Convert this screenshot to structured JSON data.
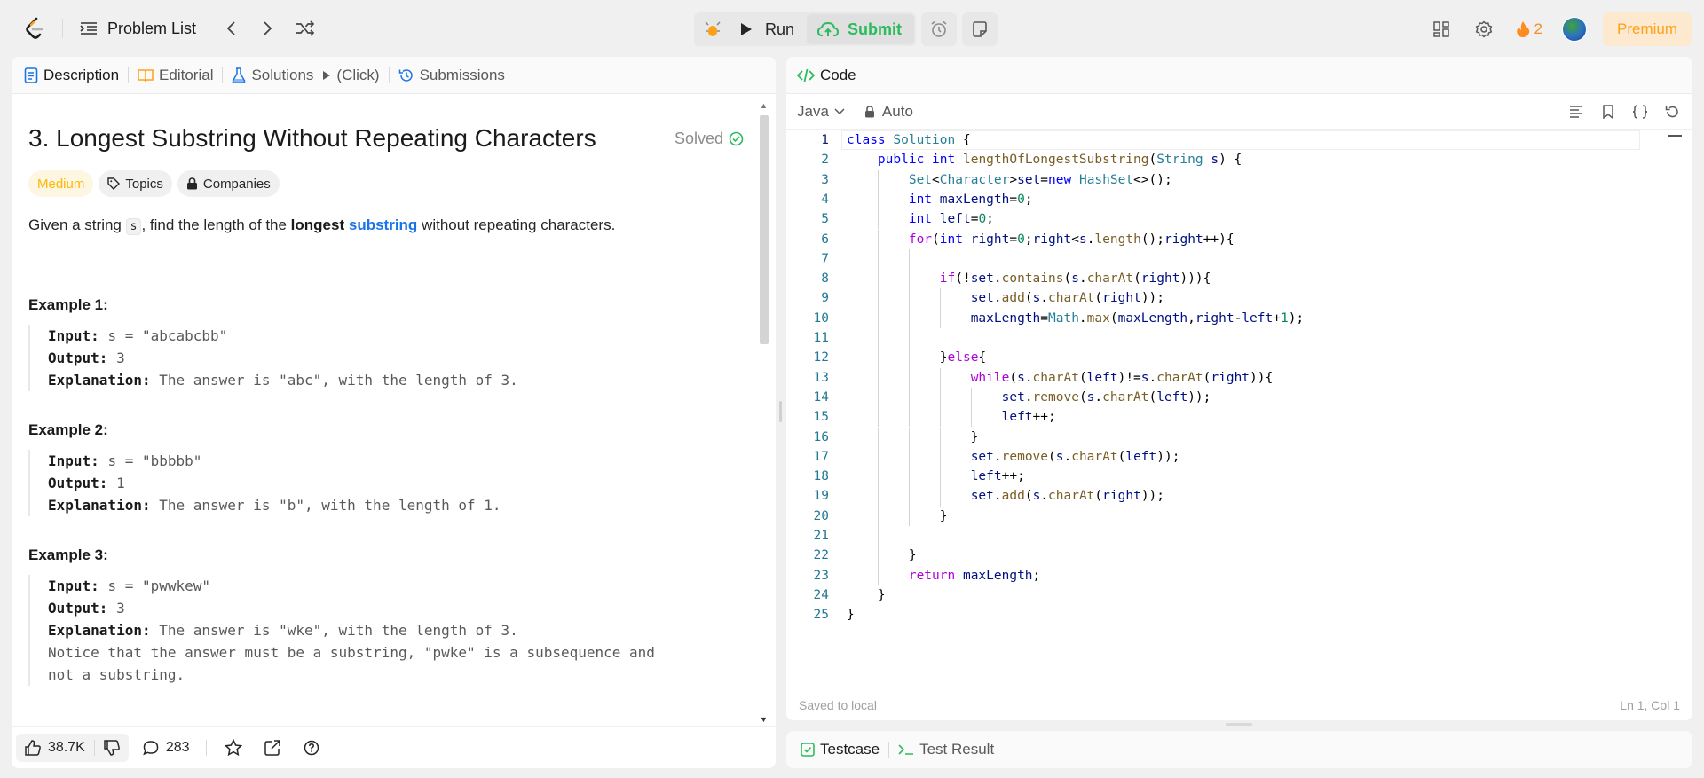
{
  "nav": {
    "problem_list": "Problem List",
    "run": "Run",
    "submit": "Submit",
    "streak": "2",
    "premium": "Premium"
  },
  "left_tabs": [
    {
      "label": "Description",
      "icon": "description-icon"
    },
    {
      "label": "Editorial",
      "icon": "book-icon"
    },
    {
      "label": "Solutions",
      "icon": "flask-icon"
    },
    {
      "label": "(Click)",
      "icon": "play-icon"
    },
    {
      "label": "Submissions",
      "icon": "history-icon"
    }
  ],
  "problem": {
    "title": "3. Longest Substring Without Repeating Characters",
    "status": "Solved",
    "difficulty": "Medium",
    "topics_label": "Topics",
    "companies_label": "Companies",
    "statement": {
      "p1": "Given a string ",
      "code": "s",
      "p2": ", find the length of the ",
      "bold": "longest",
      "link": "substring",
      "p3": " without repeating characters."
    },
    "examples": [
      {
        "title": "Example 1:",
        "input": "s = \"abcabcbb\"",
        "output": "3",
        "explanation": "The answer is \"abc\", with the length of 3."
      },
      {
        "title": "Example 2:",
        "input": "s = \"bbbbb\"",
        "output": "1",
        "explanation": "The answer is \"b\", with the length of 1."
      },
      {
        "title": "Example 3:",
        "input": "s = \"pwwkew\"",
        "output": "3",
        "explanation": "The answer is \"wke\", with the length of 3.",
        "note1": "Notice that the answer must be a substring, \"pwke\" is a subsequence and",
        "note2": "not a substring."
      }
    ],
    "labels": {
      "input": "Input:",
      "output": "Output:",
      "explanation": "Explanation:"
    }
  },
  "footer": {
    "likes": "38.7K",
    "comments": "283"
  },
  "code_panel": {
    "title": "Code",
    "language": "Java",
    "mode": "Auto",
    "status_left": "Saved to local",
    "status_right": "Ln 1, Col 1"
  },
  "code_lines": [
    "class Solution {",
    "    public int lengthOfLongestSubstring(String s) {",
    "        Set<Character>set=new HashSet<>();",
    "        int maxLength=0;",
    "        int left=0;",
    "        for(int right=0;right<s.length();right++){",
    "",
    "            if(!set.contains(s.charAt(right))){",
    "                set.add(s.charAt(right));",
    "                maxLength=Math.max(maxLength,right-left+1);",
    "",
    "            }else{",
    "                while(s.charAt(left)!=s.charAt(right)){",
    "                    set.remove(s.charAt(left));",
    "                    left++;",
    "                }",
    "                set.remove(s.charAt(left));",
    "                left++;",
    "                set.add(s.charAt(right));",
    "            }",
    "",
    "        }",
    "        return maxLength;",
    "    }",
    "}"
  ],
  "bottom_tabs": [
    {
      "label": "Testcase",
      "icon": "checkbox-icon"
    },
    {
      "label": "Test Result",
      "icon": "terminal-icon"
    }
  ]
}
